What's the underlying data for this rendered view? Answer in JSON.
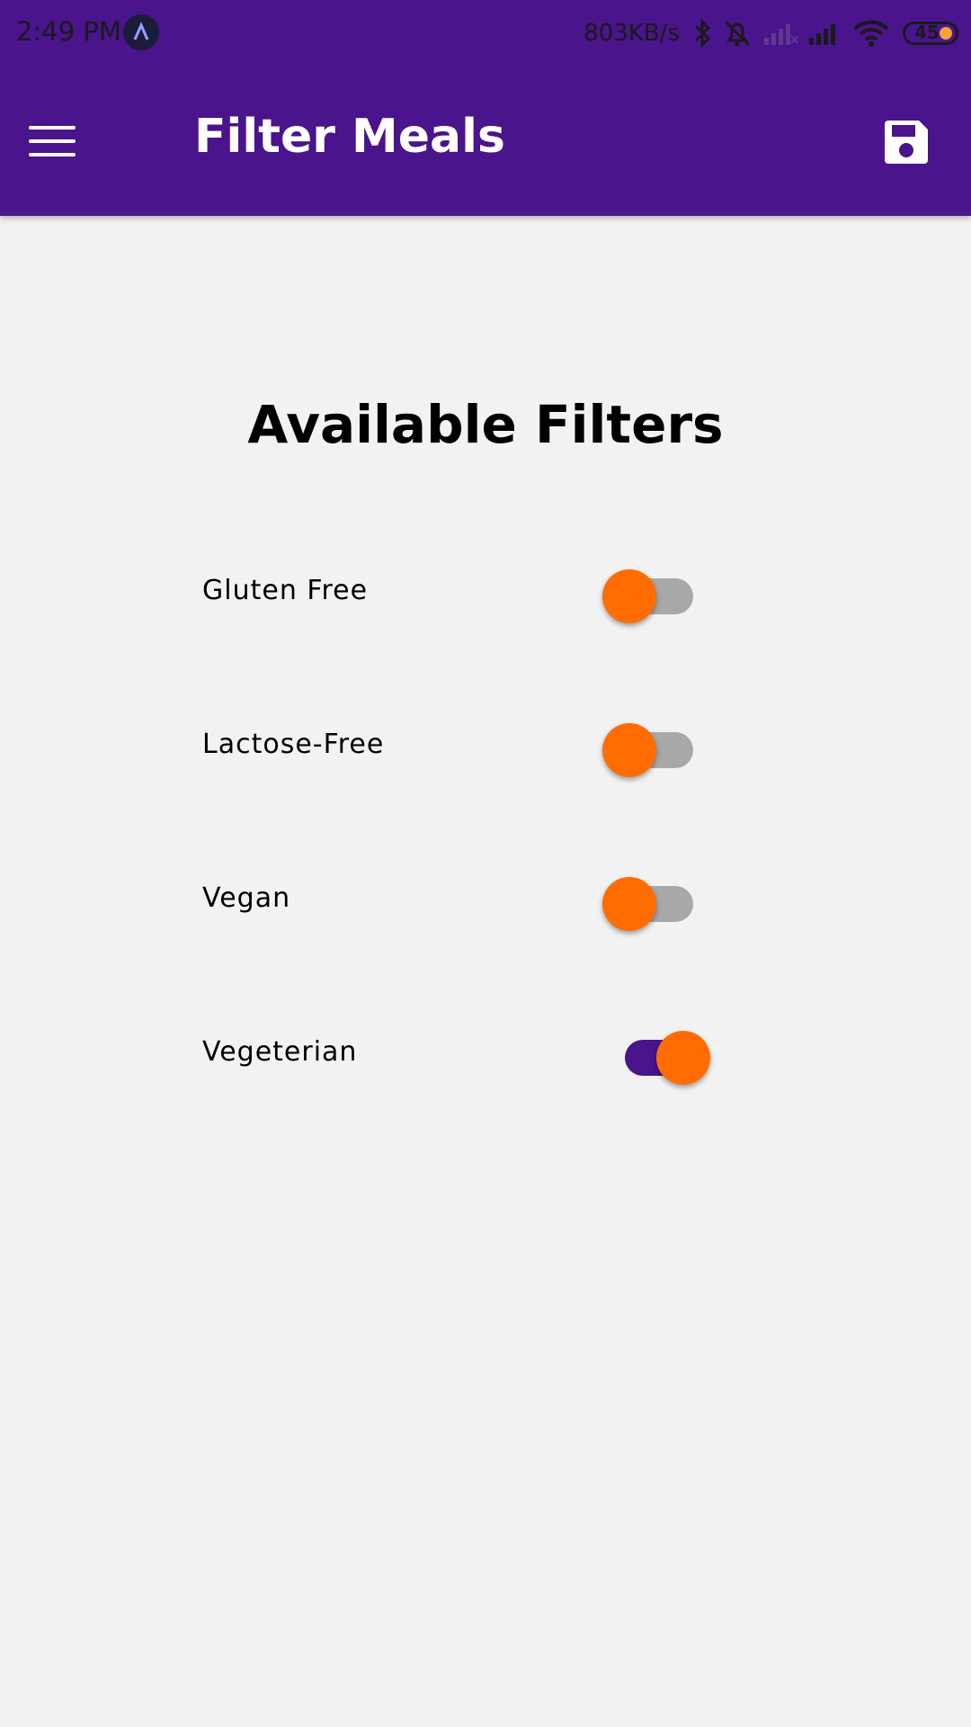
{
  "status_bar": {
    "time": "2:49 PM",
    "speed": "803KB/s",
    "battery": "45"
  },
  "app_bar": {
    "title": "Filter Meals",
    "menu_icon": "menu-icon",
    "save_icon": "save-icon"
  },
  "main": {
    "heading": "Available Filters",
    "filters": [
      {
        "label": "Gluten Free",
        "enabled": false
      },
      {
        "label": "Lactose-Free",
        "enabled": false
      },
      {
        "label": "Vegan",
        "enabled": false
      },
      {
        "label": "Vegeterian",
        "enabled": true
      }
    ]
  },
  "colors": {
    "primary": "#4a148c",
    "accent": "#ff6d00",
    "background": "#f2f2f2",
    "switch_off_track": "#a8a8a8"
  }
}
